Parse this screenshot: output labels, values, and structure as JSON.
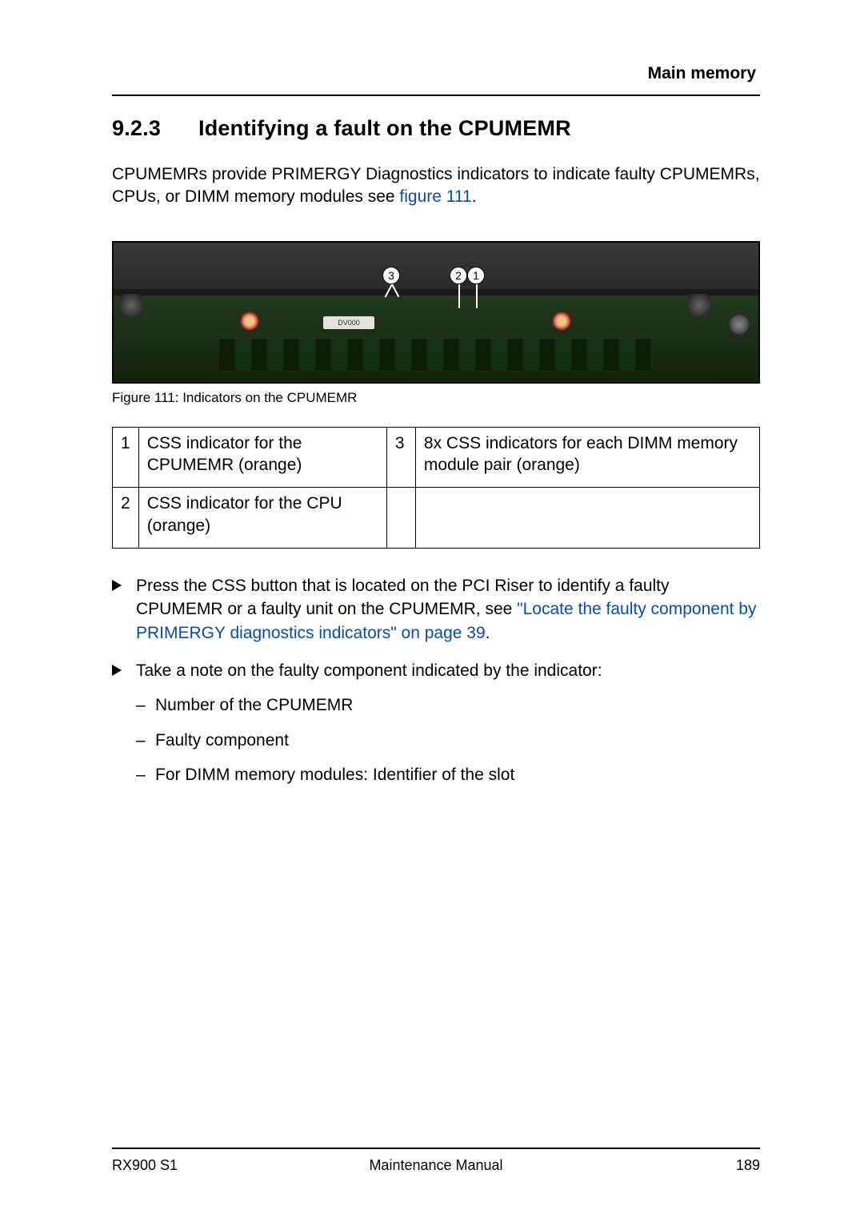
{
  "header": {
    "section": "Main memory"
  },
  "heading": {
    "number": "9.2.3",
    "title": "Identifying a fault on the CPUMEMR"
  },
  "intro": {
    "text_before_link": "CPUMEMRs provide PRIMERGY Diagnostics indicators to indicate faulty CPUMEMRs, CPUs, or DIMM memory modules see ",
    "link_text": "figure 111",
    "text_after_link": "."
  },
  "figure": {
    "board_label": "DV000",
    "callouts": {
      "c1": "1",
      "c2": "2",
      "c3": "3"
    },
    "caption": "Figure 111: Indicators on the CPUMEMR"
  },
  "legend": {
    "r1": {
      "n1": "1",
      "d1": "CSS indicator for the CPUMEMR (orange)",
      "n2": "3",
      "d2": "8x CSS indicators for each DIMM memory module pair (orange)"
    },
    "r2": {
      "n1": "2",
      "d1": "CSS indicator for the CPU (orange)",
      "n2": "",
      "d2": ""
    }
  },
  "steps": {
    "s1": {
      "pre": "Press the CSS button that is located on the PCI Riser to identify a faulty CPUMEMR or a faulty unit on the CPUMEMR, see ",
      "link": "\"Locate the faulty component by PRIMERGY diagnostics indicators\" on page 39",
      "post": "."
    },
    "s2": {
      "text": "Take a note on the faulty component indicated by the indicator:",
      "items": [
        "Number of the CPUMEMR",
        "Faulty component",
        "For DIMM memory modules: Identifier of the slot"
      ]
    }
  },
  "footer": {
    "left": "RX900 S1",
    "center": "Maintenance Manual",
    "right": "189"
  }
}
